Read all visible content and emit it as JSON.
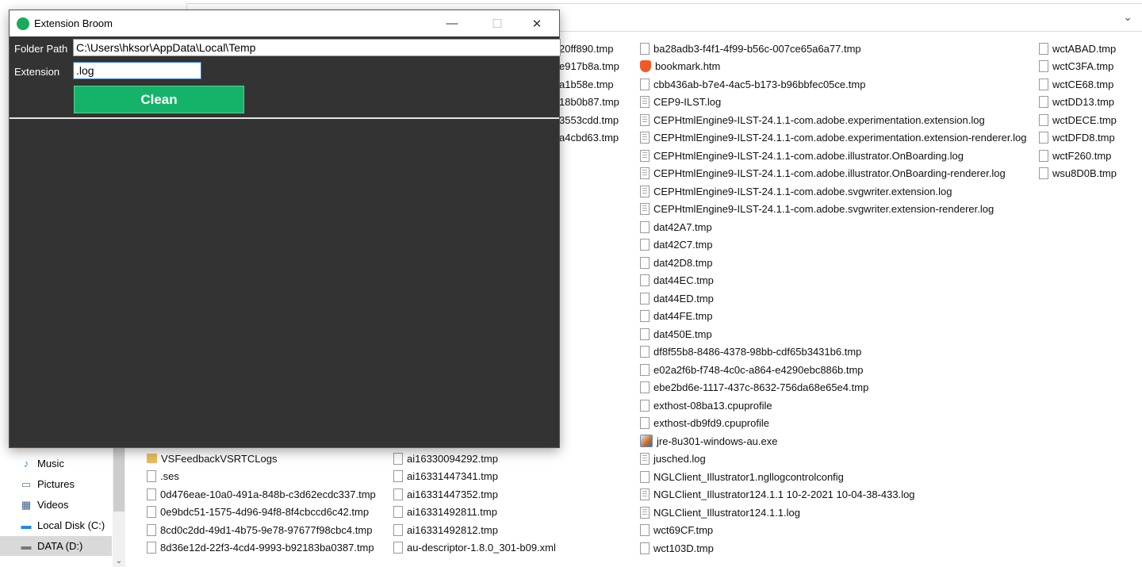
{
  "explorer": {
    "address_chevron": "⌄",
    "nav": [
      {
        "label": "Music",
        "icon": "music-icon",
        "glyph": "♪",
        "color": "#1e88e5"
      },
      {
        "label": "Pictures",
        "icon": "pictures-icon",
        "glyph": "▭",
        "color": "#5a7fa0"
      },
      {
        "label": "Videos",
        "icon": "videos-icon",
        "glyph": "▦",
        "color": "#3a5f8a"
      },
      {
        "label": "Local Disk (C:)",
        "icon": "local-disk-icon",
        "glyph": "▬",
        "color": "#1e88e5"
      },
      {
        "label": "DATA (D:)",
        "icon": "drive-icon",
        "glyph": "▬",
        "color": "#777",
        "selected": true
      }
    ],
    "column1": [
      {
        "name": "VSFeedbackVSRTCLogs",
        "type": "folder"
      },
      {
        "name": ".ses",
        "type": "file"
      },
      {
        "name": "0d476eae-10a0-491a-848b-c3d62ecdc337.tmp",
        "type": "file"
      },
      {
        "name": "0e9bdc51-1575-4d96-94f8-8f4cbccd6c42.tmp",
        "type": "file"
      },
      {
        "name": "8cd0c2dd-49d1-4b75-9e78-97677f98cbc4.tmp",
        "type": "file"
      },
      {
        "name": "8d36e12d-22f3-4cd4-9993-b92183ba0387.tmp",
        "type": "file"
      }
    ],
    "column2_partial": [
      "20ff890.tmp",
      "e917b8a.tmp",
      "a1b58e.tmp",
      "18b0b87.tmp",
      "3553cdd.tmp",
      "a4cbd63.tmp"
    ],
    "column2": [
      {
        "name": "ai16330094292.tmp",
        "type": "file"
      },
      {
        "name": "ai16331447341.tmp",
        "type": "file"
      },
      {
        "name": "ai16331447352.tmp",
        "type": "file"
      },
      {
        "name": "ai16331492811.tmp",
        "type": "file"
      },
      {
        "name": "ai16331492812.tmp",
        "type": "file"
      },
      {
        "name": "au-descriptor-1.8.0_301-b09.xml",
        "type": "file"
      }
    ],
    "column3": [
      {
        "name": "ba28adb3-f4f1-4f99-b56c-007ce65a6a77.tmp",
        "type": "file"
      },
      {
        "name": "bookmark.htm",
        "type": "brave"
      },
      {
        "name": "cbb436ab-b7e4-4ac5-b173-b96bbfec05ce.tmp",
        "type": "file"
      },
      {
        "name": "CEP9-ILST.log",
        "type": "txt"
      },
      {
        "name": "CEPHtmlEngine9-ILST-24.1.1-com.adobe.experimentation.extension.log",
        "type": "txt"
      },
      {
        "name": "CEPHtmlEngine9-ILST-24.1.1-com.adobe.experimentation.extension-renderer.log",
        "type": "txt"
      },
      {
        "name": "CEPHtmlEngine9-ILST-24.1.1-com.adobe.illustrator.OnBoarding.log",
        "type": "txt"
      },
      {
        "name": "CEPHtmlEngine9-ILST-24.1.1-com.adobe.illustrator.OnBoarding-renderer.log",
        "type": "txt"
      },
      {
        "name": "CEPHtmlEngine9-ILST-24.1.1-com.adobe.svgwriter.extension.log",
        "type": "txt"
      },
      {
        "name": "CEPHtmlEngine9-ILST-24.1.1-com.adobe.svgwriter.extension-renderer.log",
        "type": "txt"
      },
      {
        "name": "dat42A7.tmp",
        "type": "file"
      },
      {
        "name": "dat42C7.tmp",
        "type": "file"
      },
      {
        "name": "dat42D8.tmp",
        "type": "file"
      },
      {
        "name": "dat44EC.tmp",
        "type": "file"
      },
      {
        "name": "dat44ED.tmp",
        "type": "file"
      },
      {
        "name": "dat44FE.tmp",
        "type": "file"
      },
      {
        "name": "dat450E.tmp",
        "type": "file"
      },
      {
        "name": "df8f55b8-8486-4378-98bb-cdf65b3431b6.tmp",
        "type": "file"
      },
      {
        "name": "e02a2f6b-f748-4c0c-a864-e4290ebc886b.tmp",
        "type": "file"
      },
      {
        "name": "ebe2bd6e-1117-437c-8632-756da68e65e4.tmp",
        "type": "file"
      },
      {
        "name": "exthost-08ba13.cpuprofile",
        "type": "file"
      },
      {
        "name": "exthost-db9fd9.cpuprofile",
        "type": "file"
      },
      {
        "name": "jre-8u301-windows-au.exe",
        "type": "java"
      },
      {
        "name": "jusched.log",
        "type": "txt"
      },
      {
        "name": "NGLClient_Illustrator1.ngllogcontrolconfig",
        "type": "file"
      },
      {
        "name": "NGLClient_Illustrator124.1.1 10-2-2021 10-04-38-433.log",
        "type": "txt"
      },
      {
        "name": "NGLClient_Illustrator124.1.1.log",
        "type": "txt"
      },
      {
        "name": "wct69CF.tmp",
        "type": "file"
      },
      {
        "name": "wct103D.tmp",
        "type": "file"
      }
    ],
    "column4": [
      {
        "name": "wctABAD.tmp",
        "type": "file"
      },
      {
        "name": "wctC3FA.tmp",
        "type": "file"
      },
      {
        "name": "wctCE68.tmp",
        "type": "file"
      },
      {
        "name": "wctDD13.tmp",
        "type": "file"
      },
      {
        "name": "wctDECE.tmp",
        "type": "file"
      },
      {
        "name": "wctDFD8.tmp",
        "type": "file"
      },
      {
        "name": "wctF260.tmp",
        "type": "file"
      },
      {
        "name": "wsu8D0B.tmp",
        "type": "file"
      }
    ]
  },
  "app": {
    "title": "Extension Broom",
    "minimize": "—",
    "maximize": "☐",
    "close": "✕",
    "folder_label": "Folder Path",
    "folder_value": "C:\\Users\\hksor\\AppData\\Local\\Temp",
    "extension_label": "Extension",
    "extension_value": ".log",
    "clean_label": "Clean",
    "accent": "#15b369"
  }
}
